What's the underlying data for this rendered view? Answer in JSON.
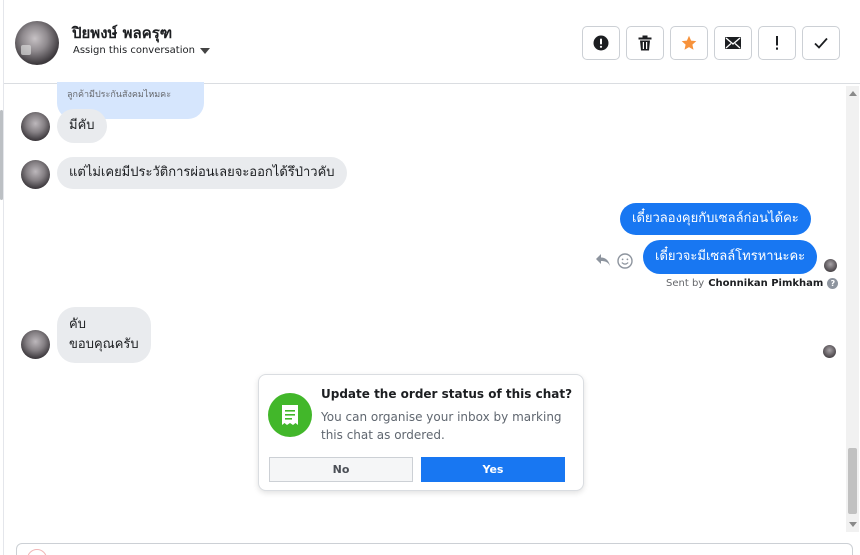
{
  "header": {
    "contact_name": "ปิยพงษ์ พลครุฑ",
    "assign_label": "Assign this conversation",
    "actions": [
      {
        "name": "mark-spam-button",
        "icon": "exclamation-circle-icon"
      },
      {
        "name": "delete-button",
        "icon": "trash-icon"
      },
      {
        "name": "star-button",
        "icon": "star-icon"
      },
      {
        "name": "mark-unread-button",
        "icon": "envelope-icon"
      },
      {
        "name": "follow-up-button",
        "icon": "exclamation-icon"
      },
      {
        "name": "mark-done-button",
        "icon": "check-icon"
      }
    ],
    "star_color": "#f7923b"
  },
  "messages": {
    "quoted_text": "ลูกค้ามีประกันสังคมไหมคะ",
    "in1": "มีคับ",
    "in2": "แต่ไม่เคยมีประวัติการผ่อนเลยจะออกได้รึป่าวคับ",
    "out1": "เดี๋ยวลองคุยกับเซลล์ก่อนได้คะ",
    "out2": "เดี๋ยวจะมีเซลล์โทรหานะคะ",
    "sent_by_prefix": "Sent by",
    "sent_by_name": "Chonnikan Pimkham",
    "in3_line1": "คับ",
    "in3_line2": "ขอบคุณครับ"
  },
  "prompt": {
    "title": "Update the order status of this chat?",
    "description": "You can organise your inbox by marking this chat as ordered.",
    "no_label": "No",
    "yes_label": "Yes",
    "icon": "receipt-icon"
  },
  "colors": {
    "accent": "#1877f2",
    "incoming_bubble": "#e9ebee",
    "quoted_bubble": "#d6e6fd",
    "prompt_icon_bg": "#42b72a"
  }
}
